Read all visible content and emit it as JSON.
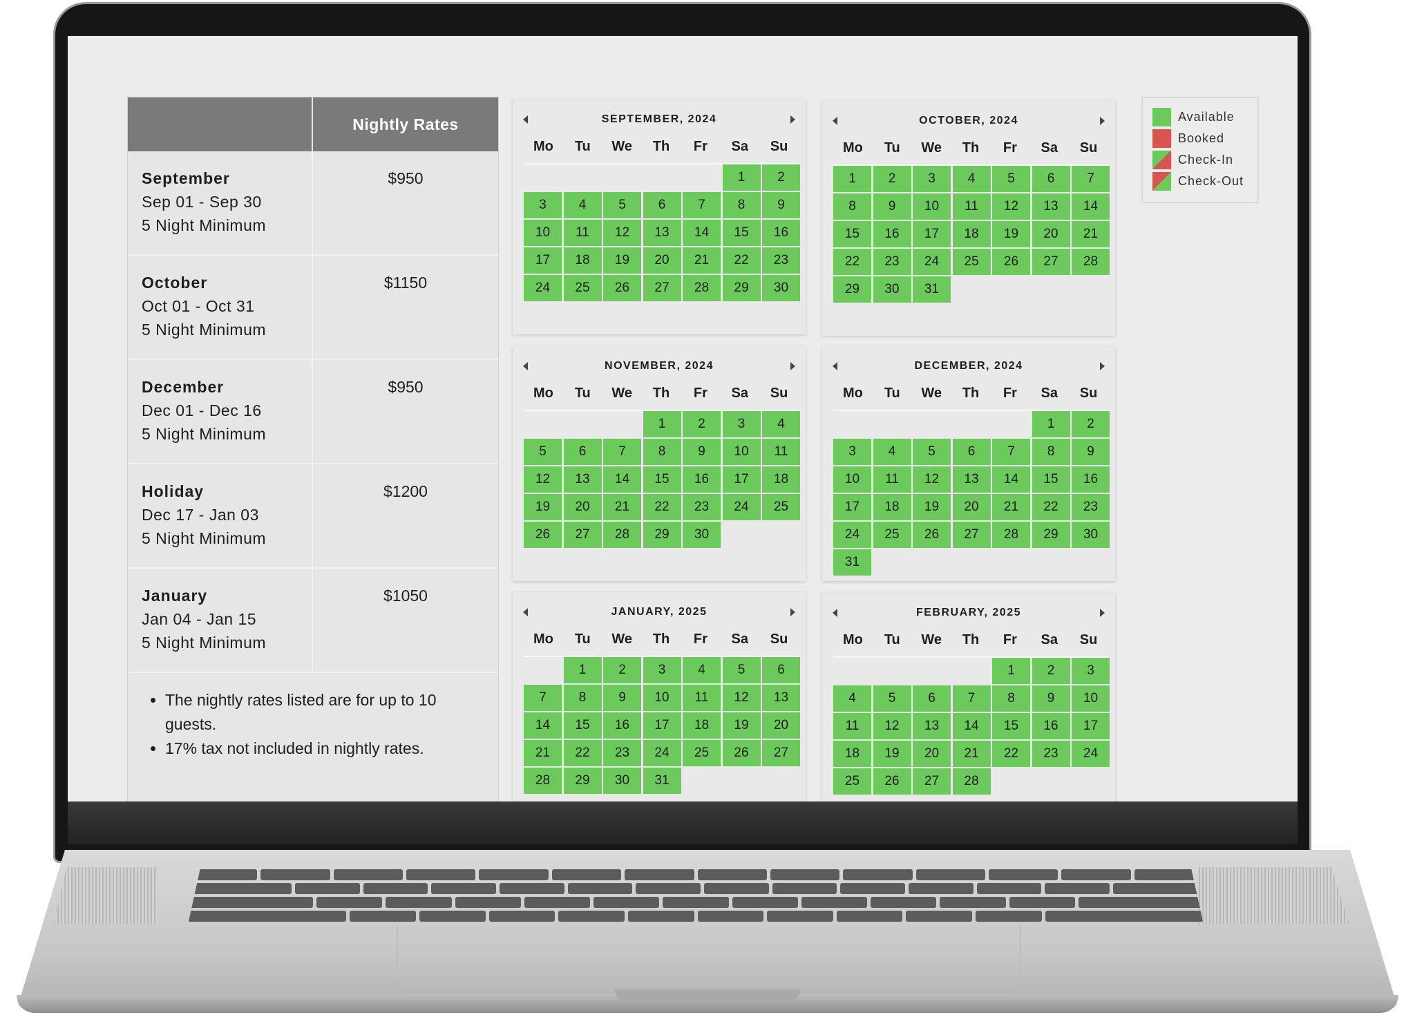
{
  "rates_table": {
    "header": "Nightly Rates",
    "rows": [
      {
        "period": "September",
        "dates": "Sep 01 - Sep 30",
        "minimum": "5 Night Minimum",
        "price": "$950"
      },
      {
        "period": "October",
        "dates": "Oct 01 - Oct 31",
        "minimum": "5 Night Minimum",
        "price": "$1150"
      },
      {
        "period": "December",
        "dates": "Dec 01 - Dec 16",
        "minimum": "5 Night Minimum",
        "price": "$950"
      },
      {
        "period": "Holiday",
        "dates": "Dec 17 - Jan 03",
        "minimum": "5 Night Minimum",
        "price": "$1200"
      },
      {
        "period": "January",
        "dates": "Jan 04 - Jan 15",
        "minimum": "5 Night Minimum",
        "price": "$1050"
      }
    ],
    "notes": [
      "The nightly rates listed are for up to 10 guests.",
      "17% tax not included in nightly rates."
    ]
  },
  "weekdays": [
    "Mo",
    "Tu",
    "We",
    "Th",
    "Fr",
    "Sa",
    "Su"
  ],
  "calendars": [
    {
      "title": "SEPTEMBER, 2024",
      "first_weekday": 6,
      "days": 30
    },
    {
      "title": "OCTOBER, 2024",
      "first_weekday": 1,
      "days": 31
    },
    {
      "title": "NOVEMBER, 2024",
      "first_weekday": 4,
      "days": 30
    },
    {
      "title": "DECEMBER, 2024",
      "first_weekday": 6,
      "days": 31
    },
    {
      "title": "JANUARY, 2025",
      "first_weekday": 2,
      "days": 31
    },
    {
      "title": "FEBRUARY, 2025",
      "first_weekday": 5,
      "days": 28
    }
  ],
  "day_status": "available",
  "legend": [
    {
      "label": "Available",
      "color": "#6cc95b"
    },
    {
      "label": "Booked",
      "color": "#d9534f"
    },
    {
      "label": "Check-In",
      "color": "split-green-red"
    },
    {
      "label": "Check-Out",
      "color": "split-red-green"
    }
  ],
  "colors": {
    "available": "#6cc95b",
    "booked": "#d9534f",
    "header": "#7a7a7a"
  }
}
